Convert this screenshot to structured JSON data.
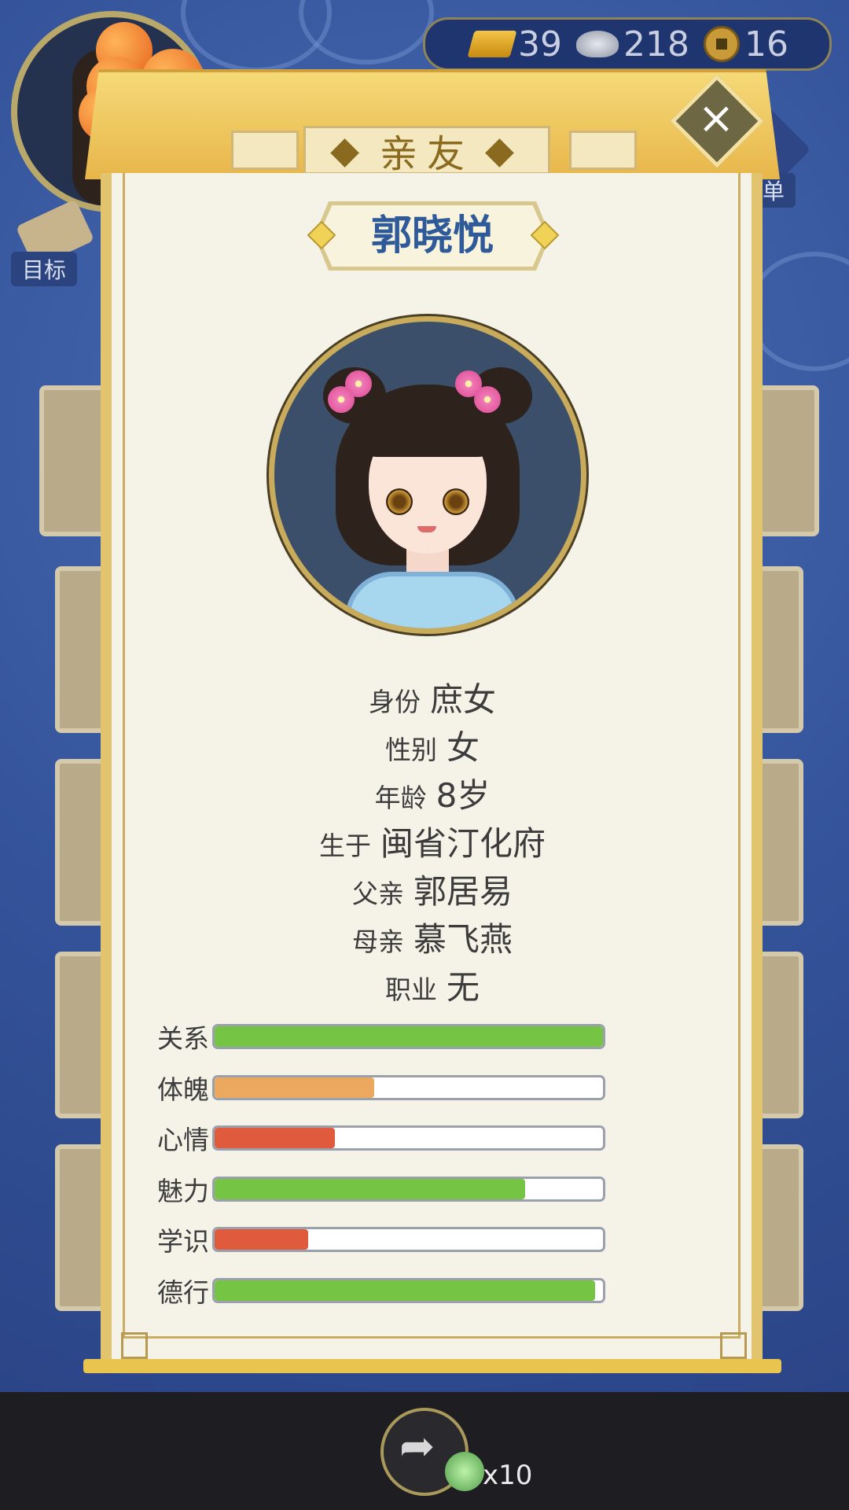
{
  "resources": {
    "gold": "39",
    "silver": "218",
    "coins": "16"
  },
  "side_buttons": {
    "goal_label": "目标",
    "menu_label": "菜单"
  },
  "dialog": {
    "title": "亲友",
    "name": "郭晓悦",
    "info": [
      {
        "label": "身份",
        "value": "庶女"
      },
      {
        "label": "性别",
        "value": "女"
      },
      {
        "label": "年龄",
        "value": "8岁"
      },
      {
        "label": "生于",
        "value": "闽省汀化府"
      },
      {
        "label": "父亲",
        "value": "郭居易"
      },
      {
        "label": "母亲",
        "value": "慕飞燕"
      },
      {
        "label": "职业",
        "value": "无"
      }
    ],
    "stats": [
      {
        "label": "关系",
        "fraction": 1.0,
        "color": "#76c443"
      },
      {
        "label": "体魄",
        "fraction": 0.41,
        "color": "#eda860"
      },
      {
        "label": "心情",
        "fraction": 0.31,
        "color": "#e05a3e"
      },
      {
        "label": "魅力",
        "fraction": 0.8,
        "color": "#76c443"
      },
      {
        "label": "学识",
        "fraction": 0.24,
        "color": "#e05a3e"
      },
      {
        "label": "德行",
        "fraction": 0.98,
        "color": "#76c443"
      }
    ]
  },
  "bottom": {
    "share_count": "x10"
  }
}
